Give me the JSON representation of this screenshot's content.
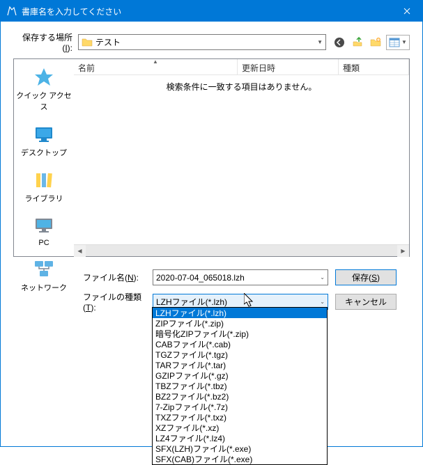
{
  "titlebar": {
    "title": "書庫名を入力してください"
  },
  "toprow": {
    "label_pre": "保存する場所(",
    "label_u": "I",
    "label_post": "):",
    "location": "テスト"
  },
  "columns": {
    "name": "名前",
    "date": "更新日時",
    "type": "種類"
  },
  "empty_message": "検索条件に一致する項目はありません。",
  "places": {
    "quick": "クイック アクセス",
    "desktop": "デスクトップ",
    "libraries": "ライブラリ",
    "pc": "PC",
    "network": "ネットワーク"
  },
  "filename": {
    "label_pre": "ファイル名(",
    "label_u": "N",
    "label_post": "):",
    "value": "2020-07-04_065018.lzh"
  },
  "filetype": {
    "label_pre": "ファイルの種類(",
    "label_u": "T",
    "label_post": "):",
    "value": "LZHファイル(*.lzh)",
    "options": [
      "LZHファイル(*.lzh)",
      "ZIPファイル(*.zip)",
      "暗号化ZIPファイル(*.zip)",
      "CABファイル(*.cab)",
      "TGZファイル(*.tgz)",
      "TARファイル(*.tar)",
      "GZIPファイル(*.gz)",
      "TBZファイル(*.tbz)",
      "BZ2ファイル(*.bz2)",
      "7-Zipファイル(*.7z)",
      "TXZファイル(*.txz)",
      "XZファイル(*.xz)",
      "LZ4ファイル(*.lz4)",
      "SFX(LZH)ファイル(*.exe)",
      "SFX(CAB)ファイル(*.exe)"
    ]
  },
  "buttons": {
    "save_pre": "保存(",
    "save_u": "S",
    "save_post": ")",
    "cancel": "キャンセル"
  }
}
